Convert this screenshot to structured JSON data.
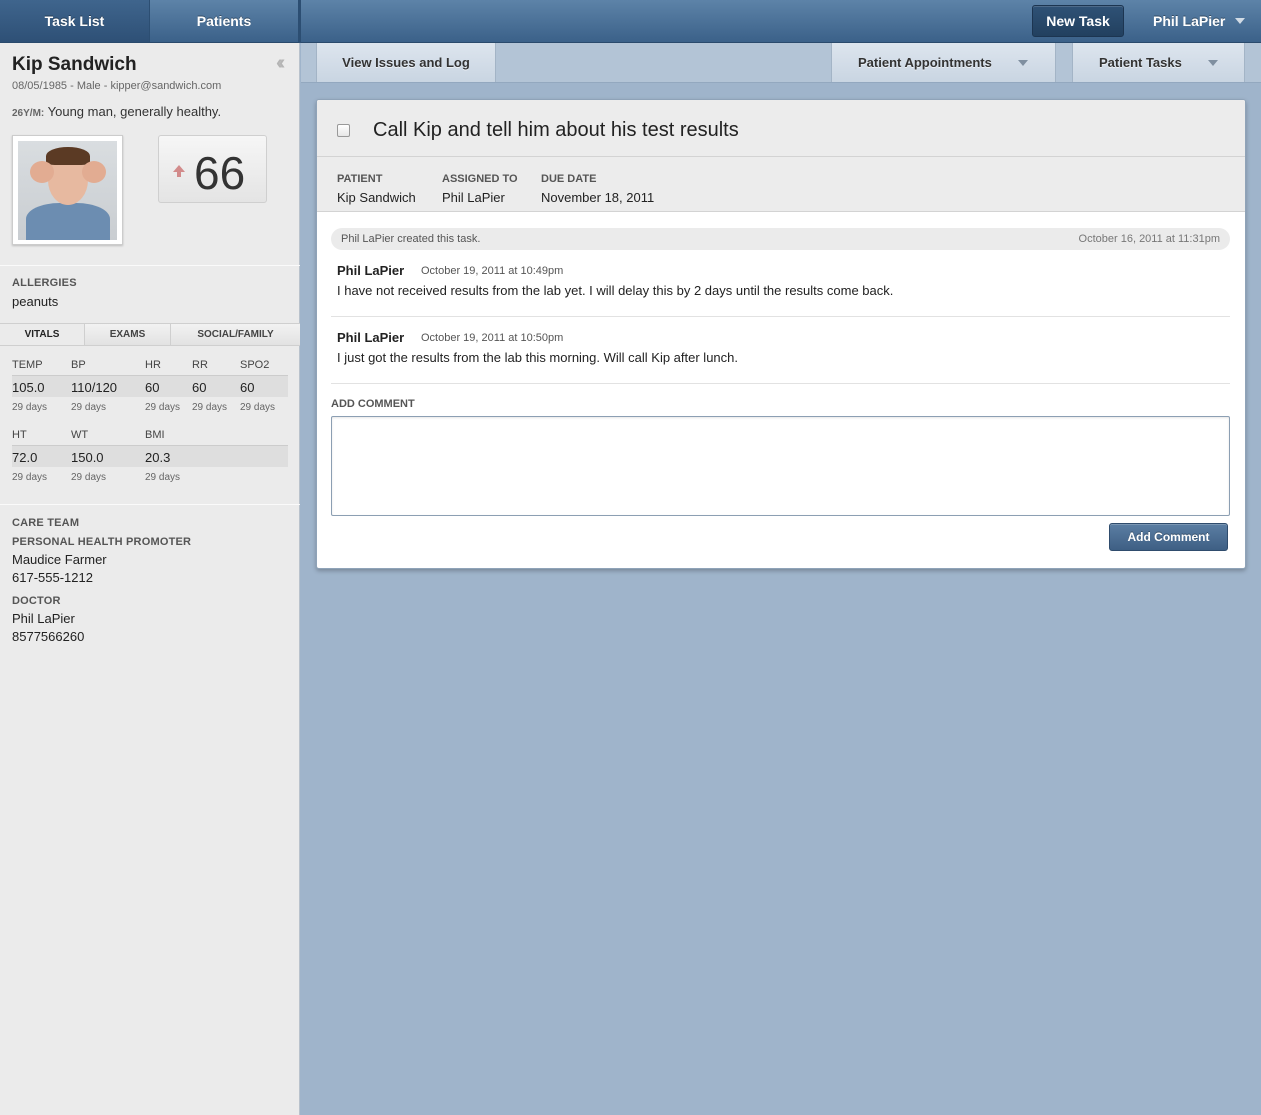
{
  "topnav": {
    "task_list": "Task List",
    "patients": "Patients",
    "new_task": "New Task",
    "user": "Phil LaPier"
  },
  "patient": {
    "name": "Kip Sandwich",
    "meta": "08/05/1985 - Male - kipper@sandwich.com",
    "age_tag": "26Y/M:",
    "summary": "Young man, generally healthy.",
    "score": "66",
    "score_trend": "up"
  },
  "allergies": {
    "label": "ALLERGIES",
    "value": "peanuts"
  },
  "tabs": [
    "VITALS",
    "EXAMS",
    "SOCIAL/FAMILY"
  ],
  "vitals": {
    "row1": {
      "headers": [
        "TEMP",
        "BP",
        "HR",
        "RR",
        "SPO2"
      ],
      "values": [
        "105.0",
        "110/120",
        "60",
        "60",
        "60"
      ],
      "ages": [
        "29 days",
        "29 days",
        "29 days",
        "29 days",
        "29 days"
      ]
    },
    "row2": {
      "headers": [
        "HT",
        "WT",
        "BMI"
      ],
      "values": [
        "72.0",
        "150.0",
        "20.3"
      ],
      "ages": [
        "29 days",
        "29 days",
        "29 days"
      ]
    }
  },
  "care_team": {
    "label": "CARE TEAM",
    "promoter_label": "PERSONAL HEALTH PROMOTER",
    "promoter_name": "Maudice Farmer",
    "promoter_phone": "617-555-1212",
    "doctor_label": "DOCTOR",
    "doctor_name": "Phil LaPier",
    "doctor_phone": "8577566260"
  },
  "toolbar": {
    "issues": "View Issues and Log",
    "appointments": "Patient Appointments",
    "tasks": "Patient Tasks"
  },
  "task": {
    "title": "Call Kip and tell him about his test results",
    "patient_label": "PATIENT",
    "patient_value": "Kip Sandwich",
    "assigned_label": "ASSIGNED TO",
    "assigned_value": "Phil LaPier",
    "due_label": "DUE DATE",
    "due_value": "November 18, 2011",
    "created_text": "Phil LaPier created this task.",
    "created_date": "October 16, 2011 at 11:31pm"
  },
  "comments": [
    {
      "author": "Phil LaPier",
      "date": "October 19, 2011 at 10:49pm",
      "text": "I have not received results from the lab yet. I will delay this by 2 days until the results come back."
    },
    {
      "author": "Phil LaPier",
      "date": "October 19, 2011 at 10:50pm",
      "text": "I just got the results from the lab this morning. Will call Kip after lunch."
    }
  ],
  "add_comment": {
    "label": "ADD COMMENT",
    "button": "Add Comment",
    "value": ""
  }
}
